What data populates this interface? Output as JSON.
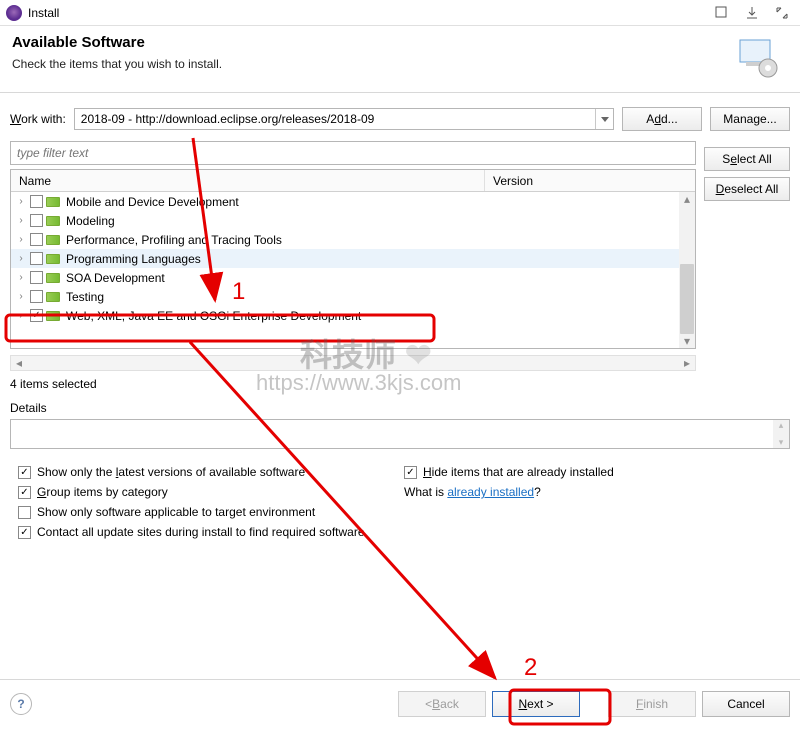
{
  "window": {
    "title": "Install"
  },
  "header": {
    "title": "Available Software",
    "subtitle": "Check the items that you wish to install."
  },
  "workwith": {
    "label_pre": "W",
    "label_post": "ork with:",
    "value": "2018-09 - http://download.eclipse.org/releases/2018-09",
    "add_btn_pre": "A",
    "add_btn_mid": "d",
    "add_btn_post": "d...",
    "manage_btn_pre": "Mana",
    "manage_btn_mid": "g",
    "manage_btn_post": "e..."
  },
  "sidebuttons": {
    "select_all_pre": "S",
    "select_all_mid": "e",
    "select_all_post": "lect All",
    "deselect_all_pre": "",
    "deselect_all_mid": "D",
    "deselect_all_post": "eselect All"
  },
  "filter": {
    "placeholder": "type filter text"
  },
  "columns": {
    "name": "Name",
    "version": "Version"
  },
  "tree": [
    {
      "label": "Mobile and Device Development",
      "checked": false,
      "selected": false
    },
    {
      "label": "Modeling",
      "checked": false,
      "selected": false
    },
    {
      "label": "Performance, Profiling and Tracing Tools",
      "checked": false,
      "selected": false
    },
    {
      "label": "Programming Languages",
      "checked": false,
      "selected": true
    },
    {
      "label": "SOA Development",
      "checked": false,
      "selected": false
    },
    {
      "label": "Testing",
      "checked": false,
      "selected": false
    },
    {
      "label": "Web, XML, Java EE and OSGi Enterprise Development",
      "checked": true,
      "selected": false
    }
  ],
  "status": "4 items selected",
  "details": {
    "title": "Details"
  },
  "options": {
    "latest": {
      "pre": "Show only the ",
      "u": "l",
      "post": "atest versions of available software",
      "checked": true
    },
    "group": {
      "pre": "",
      "u": "G",
      "post": "roup items by category",
      "checked": true
    },
    "target": {
      "pre": "Show only software applicable to target environment",
      "checked": false
    },
    "contact": {
      "pre": "Contact all update sites during install to find required software",
      "checked": true
    },
    "hide": {
      "pre": "",
      "u": "H",
      "post": "ide items that are already installed",
      "checked": true
    },
    "what_is_pre": "What is ",
    "what_is_link": "already installed",
    "what_is_post": "?"
  },
  "footer": {
    "back_pre": "< ",
    "back_u": "B",
    "back_post": "ack",
    "next_u": "N",
    "next_post": "ext >",
    "finish_u": "F",
    "finish_post": "inish",
    "cancel": "Cancel"
  },
  "annot": {
    "num1": "1",
    "num2": "2"
  },
  "watermark": {
    "line1": "科技师",
    "line2": "https://www.3kjs.com"
  }
}
